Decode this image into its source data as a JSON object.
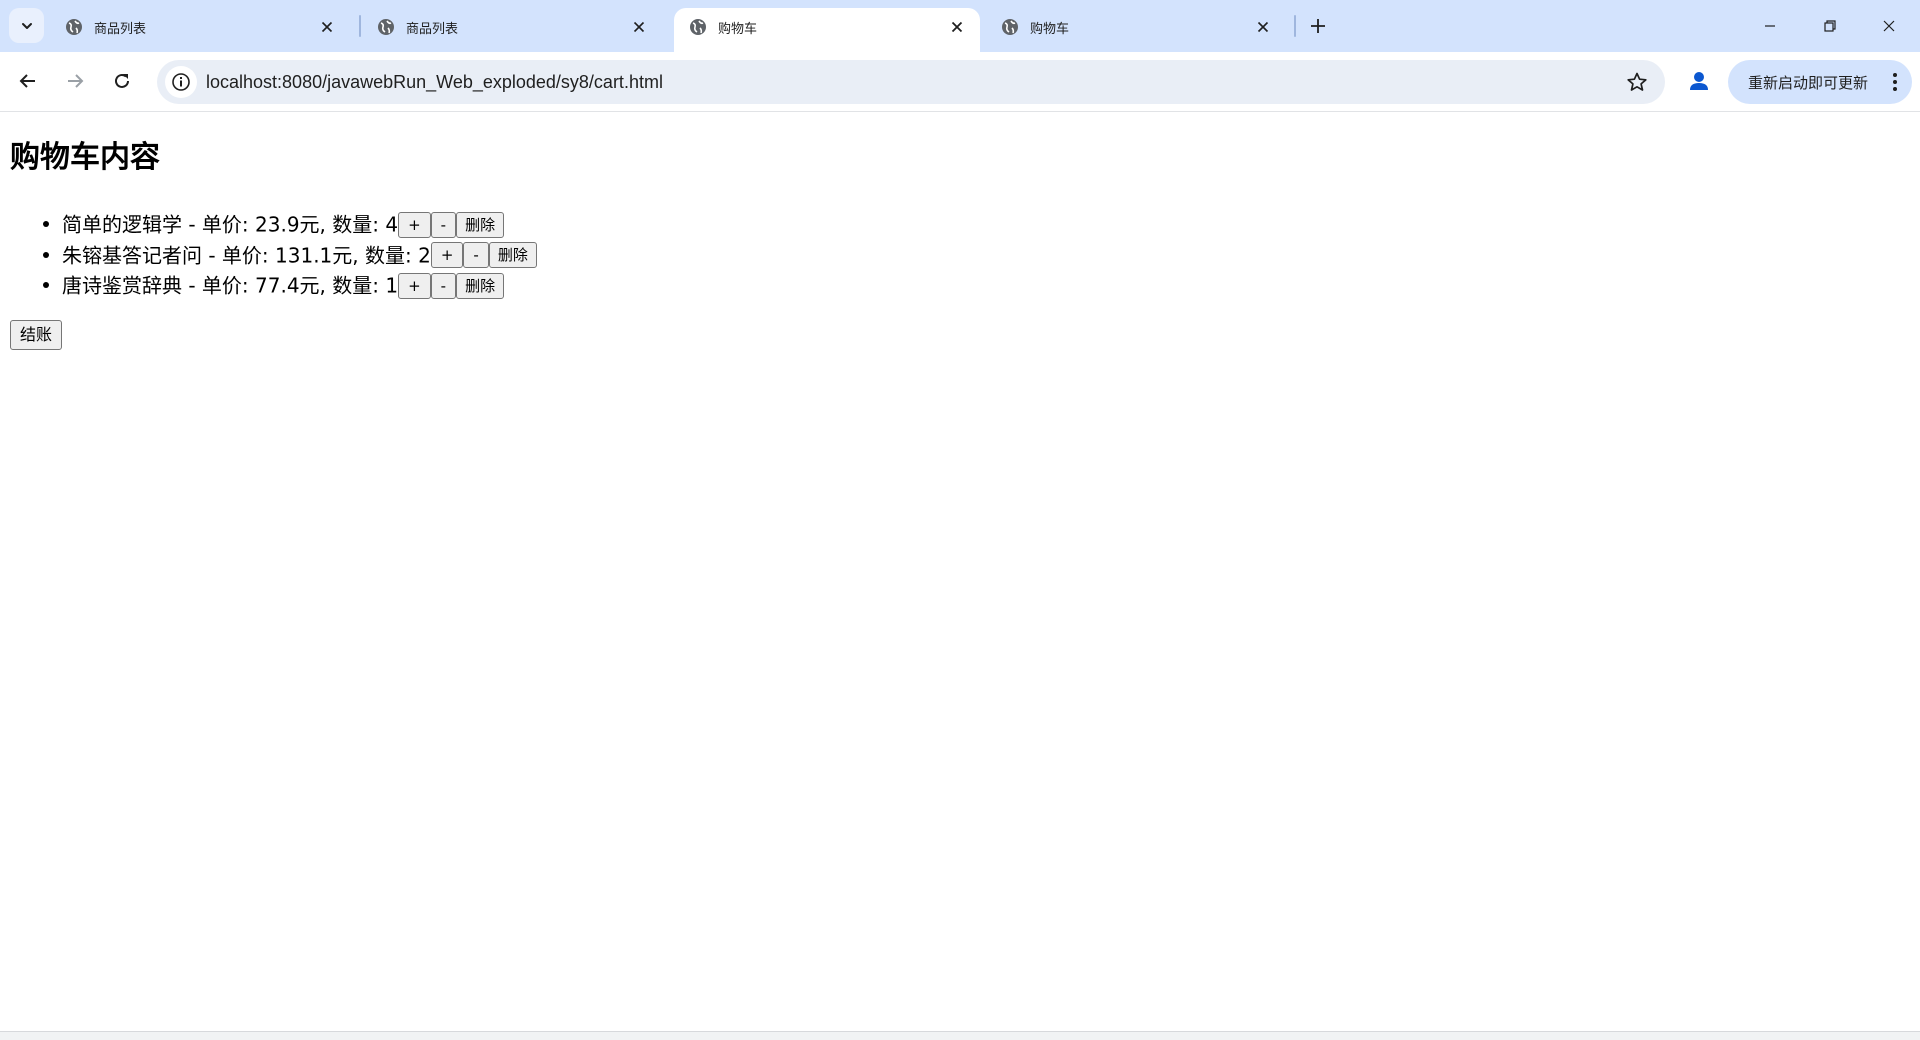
{
  "browser": {
    "tabs": [
      {
        "title": "商品列表",
        "active": false
      },
      {
        "title": "商品列表",
        "active": false
      },
      {
        "title": "购物车",
        "active": true
      },
      {
        "title": "购物车",
        "active": false
      }
    ],
    "url": "localhost:8080/javawebRun_Web_exploded/sy8/cart.html",
    "update_label": "重新启动即可更新"
  },
  "page": {
    "heading": "购物车内容",
    "items": [
      {
        "text": "简单的逻辑学 - 单价: 23.9元, 数量: 4"
      },
      {
        "text": "朱镕基答记者问 - 单价: 131.1元, 数量: 2"
      },
      {
        "text": "唐诗鉴赏辞典 - 单价: 77.4元, 数量: 1"
      }
    ],
    "buttons": {
      "plus": "+",
      "minus": "-",
      "delete": "删除"
    },
    "checkout_label": "结账"
  }
}
